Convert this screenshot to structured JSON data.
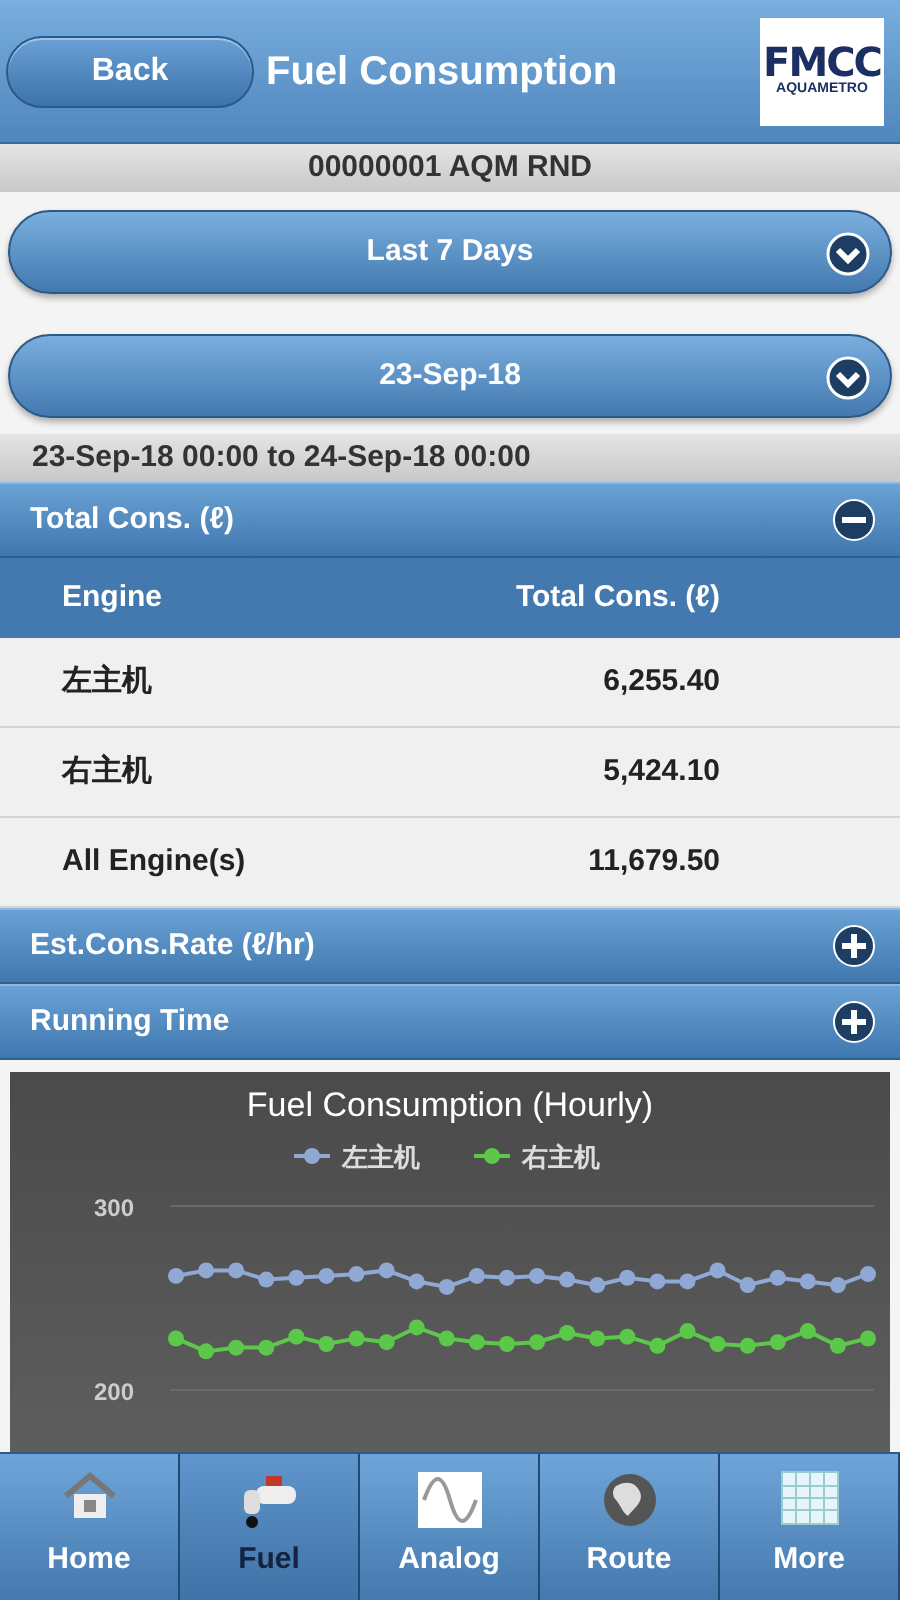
{
  "header": {
    "back": "Back",
    "title": "Fuel Consumption",
    "logo": {
      "brand": "FMCC",
      "sub": "AQUAMETRO"
    }
  },
  "vessel": "00000001 AQM RND",
  "selects": [
    {
      "value": "Last 7 Days"
    },
    {
      "value": "23-Sep-18"
    }
  ],
  "range": "23-Sep-18 00:00 to 24-Sep-18 00:00",
  "sections": [
    {
      "title": "Total Cons. (ℓ)",
      "expanded": true,
      "table": {
        "columns": [
          "Engine",
          "Total Cons. (ℓ)"
        ],
        "rows": [
          [
            "左主机",
            "6,255.40"
          ],
          [
            "右主机",
            "5,424.10"
          ],
          [
            "All Engine(s)",
            "11,679.50"
          ]
        ]
      }
    },
    {
      "title": "Est.Cons.Rate (ℓ/hr)",
      "expanded": false
    },
    {
      "title": "Running Time",
      "expanded": false
    }
  ],
  "chart_data": {
    "type": "line",
    "title": "Fuel Consumption (Hourly)",
    "ylim": [
      200,
      300
    ],
    "yticks": [
      200,
      300
    ],
    "legend": true,
    "series": [
      {
        "name": "左主机",
        "color": "#8fa8d4",
        "marker": "circle",
        "values": [
          262,
          265,
          265,
          260,
          261,
          262,
          263,
          265,
          259,
          256,
          262,
          261,
          262,
          260,
          257,
          261,
          259,
          259,
          265,
          257,
          261,
          259,
          257,
          263
        ]
      },
      {
        "name": "右主机",
        "color": "#5cc84a",
        "marker": "circle",
        "values": [
          228,
          221,
          223,
          223,
          229,
          225,
          228,
          226,
          234,
          228,
          226,
          225,
          226,
          231,
          228,
          229,
          224,
          232,
          225,
          224,
          226,
          232,
          224,
          228
        ]
      }
    ]
  },
  "tabs": [
    {
      "label": "Home",
      "selected": false
    },
    {
      "label": "Fuel",
      "selected": true
    },
    {
      "label": "Analog",
      "selected": false
    },
    {
      "label": "Route",
      "selected": false
    },
    {
      "label": "More",
      "selected": false
    }
  ]
}
